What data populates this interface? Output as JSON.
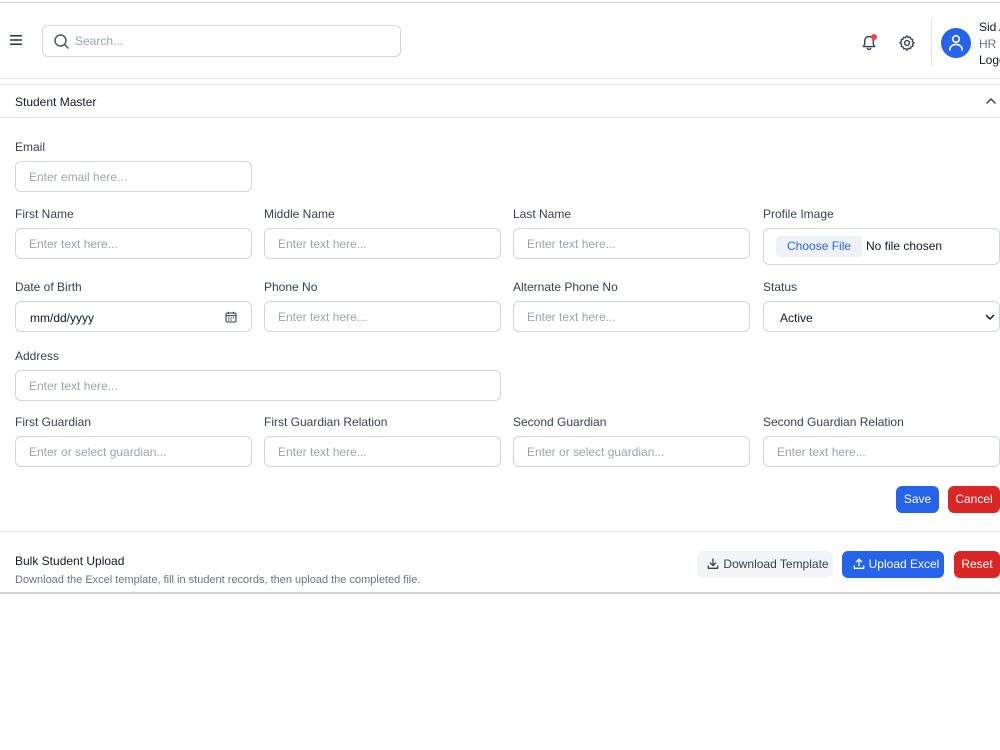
{
  "header": {
    "search_placeholder": "Search...",
    "user": {
      "name": "Sid A",
      "role": "HR",
      "logout": "Logout"
    }
  },
  "panel": {
    "title": "Student Master",
    "fields": {
      "email": {
        "label": "Email",
        "placeholder": "Enter email here..."
      },
      "first_name": {
        "label": "First Name",
        "placeholder": "Enter text here..."
      },
      "middle_name": {
        "label": "Middle Name",
        "placeholder": "Enter text here..."
      },
      "last_name": {
        "label": "Last Name",
        "placeholder": "Enter text here..."
      },
      "profile_image": {
        "label": "Profile Image",
        "button": "Choose File",
        "status": "No file chosen"
      },
      "dob": {
        "label": "Date of Birth",
        "value": "mm/dd/yyyy"
      },
      "phone": {
        "label": "Phone No",
        "placeholder": "Enter text here..."
      },
      "alt_phone": {
        "label": "Alternate Phone No",
        "placeholder": "Enter text here..."
      },
      "status": {
        "label": "Status",
        "value": "Active"
      },
      "address": {
        "label": "Address",
        "placeholder": "Enter text here..."
      },
      "first_guardian": {
        "label": "First Guardian",
        "placeholder": "Enter or select guardian..."
      },
      "first_guardian_relation": {
        "label": "First Guardian Relation",
        "placeholder": "Enter text here..."
      },
      "second_guardian": {
        "label": "Second Guardian",
        "placeholder": "Enter or select guardian..."
      },
      "second_guardian_relation": {
        "label": "Second Guardian Relation",
        "placeholder": "Enter text here..."
      }
    },
    "actions": {
      "save": "Save",
      "cancel": "Cancel"
    }
  },
  "bulk": {
    "title": "Bulk Student Upload",
    "description": "Download the Excel template, fill in student records, then upload the completed file.",
    "download": "Download Template",
    "upload": "Upload Excel",
    "reset": "Reset"
  },
  "colors": {
    "primary": "#2563eb",
    "danger": "#dc2626",
    "notification": "#ef4444"
  }
}
